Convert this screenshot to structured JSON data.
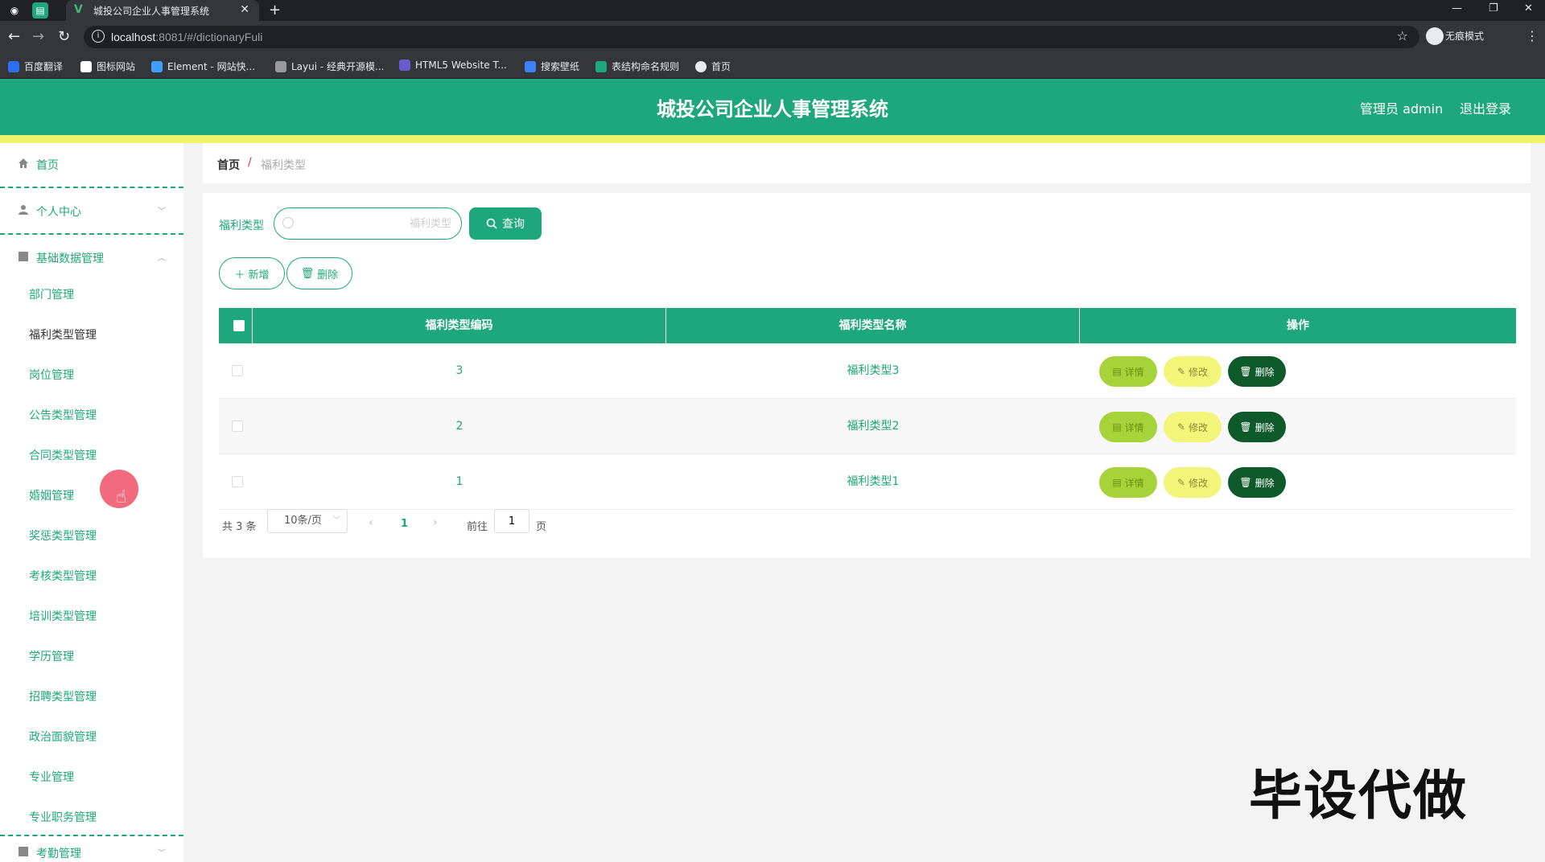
{
  "browser": {
    "tab_title": "城投公司企业人事管理系统",
    "url_host": "localhost",
    "url_path": ":8081/#/dictionaryFuli",
    "profile_label": "无痕模式",
    "bookmarks": [
      {
        "label": "百度翻译",
        "color": "#2d6ff2"
      },
      {
        "label": "图标网站",
        "color": "#ffffff"
      },
      {
        "label": "Element - 网站快...",
        "color": "#409eff"
      },
      {
        "label": "Layui - 经典开源模...",
        "color": "#9a9a9a"
      },
      {
        "label": "HTML5 Website T...",
        "color": "#6a5acd"
      },
      {
        "label": "搜索壁纸",
        "color": "#3b82f6"
      },
      {
        "label": "表结构命名规则",
        "color": "#1ea77a"
      },
      {
        "label": "首页",
        "color": "#e8eaed"
      }
    ]
  },
  "header": {
    "title": "城投公司企业人事管理系统",
    "user": "管理员 admin",
    "logout": "退出登录"
  },
  "sidebar": {
    "home": "首页",
    "personal": "个人中心",
    "basic_data": "基础数据管理",
    "sub_items": [
      "部门管理",
      "福利类型管理",
      "岗位管理",
      "公告类型管理",
      "合同类型管理",
      "婚姻管理",
      "奖惩类型管理",
      "考核类型管理",
      "培训类型管理",
      "学历管理",
      "招聘类型管理",
      "政治面貌管理",
      "专业管理",
      "专业职务管理"
    ],
    "active_index": 1,
    "next_group": "考勤管理"
  },
  "breadcrumb": {
    "home": "首页",
    "separator": "/",
    "current": "福利类型"
  },
  "search": {
    "label": "福利类型",
    "placeholder": "福利类型",
    "value": "",
    "query_button": "查询"
  },
  "actions": {
    "add": "新增",
    "delete": "删除"
  },
  "table": {
    "columns": [
      "福利类型编码",
      "福利类型名称",
      "操作"
    ],
    "rows": [
      {
        "code": "3",
        "name": "福利类型3"
      },
      {
        "code": "2",
        "name": "福利类型2"
      },
      {
        "code": "1",
        "name": "福利类型1"
      }
    ],
    "row_actions": {
      "detail": "详情",
      "edit": "修改",
      "remove": "删除"
    }
  },
  "pagination": {
    "total": "共 3 条",
    "page_size": "10条/页",
    "current_page": "1",
    "goto_label": "前往",
    "goto_value": "1",
    "page_suffix": "页"
  },
  "watermark": "毕设代做",
  "colors": {
    "primary": "#1ea77a",
    "stripe": "#eef36a",
    "detail": "#a7d33a",
    "edit": "#f2f57a",
    "remove": "#0f5a2a"
  }
}
